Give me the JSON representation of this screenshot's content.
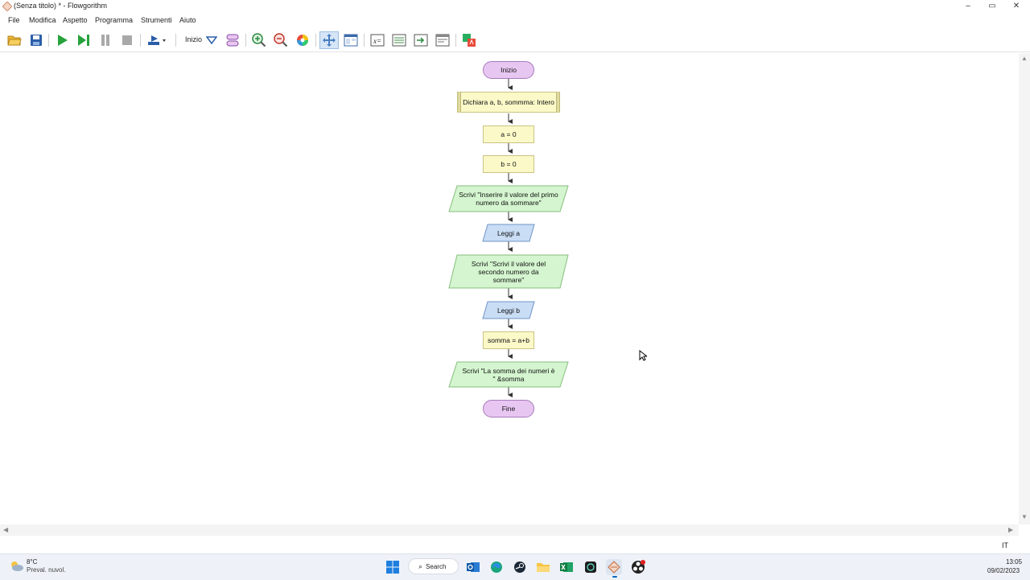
{
  "window": {
    "title": "(Senza titolo) * - Flowgorithm",
    "minimize_glyph": "–",
    "maximize_glyph": "▭",
    "close_glyph": "✕"
  },
  "menu": {
    "items": [
      "File",
      "Modifica",
      "Aspetto",
      "Programma",
      "Strumenti",
      "Aiuto"
    ]
  },
  "toolbar": {
    "start_label": "Inizio",
    "icons": [
      "open-folder-icon",
      "save-icon",
      "run-icon",
      "step-icon",
      "pause-icon",
      "stop-icon",
      "run-options-icon",
      "dropdown-arrow-icon",
      "layout-icon",
      "zoom-in-icon",
      "zoom-out-icon",
      "color-wheel-icon",
      "move-icon",
      "panels-icon",
      "variable-watch-icon",
      "console-icon",
      "output-icon",
      "source-view-icon",
      "translate-icon"
    ]
  },
  "flowchart": {
    "nodes": [
      {
        "id": "start",
        "type": "terminal",
        "text": "Inizio"
      },
      {
        "id": "declare",
        "type": "declare",
        "text": "Dichiara a, b, sommma: Intero"
      },
      {
        "id": "assign_a",
        "type": "assign",
        "text": "a = 0"
      },
      {
        "id": "assign_b",
        "type": "assign",
        "text": "b = 0"
      },
      {
        "id": "output1",
        "type": "output",
        "text": "Scrivi \"Inserire il valore del primo numero da sommare\""
      },
      {
        "id": "input_a",
        "type": "input",
        "text": "Leggi a"
      },
      {
        "id": "output2",
        "type": "output",
        "text": "Scrivi \"Scrivi il valore del secondo numero da sommare\""
      },
      {
        "id": "input_b",
        "type": "input",
        "text": "Leggi b"
      },
      {
        "id": "assign_sum",
        "type": "assign",
        "text": "somma = a+b"
      },
      {
        "id": "output3",
        "type": "output",
        "text": "Scrivi \"La somma dei numeri è \" &somma"
      },
      {
        "id": "end",
        "type": "terminal",
        "text": "Fine"
      }
    ],
    "colors": {
      "terminal": "#e8c6f2",
      "assign": "#fbf9c8",
      "output": "#d4f5cf",
      "input": "#c9ddf5"
    }
  },
  "status": {
    "language": "IT"
  },
  "taskbar": {
    "weather_temp": "8°C",
    "weather_desc": "Preval. nuvol.",
    "search_label": "Search",
    "time": "13:05",
    "date": "09/02/2023",
    "apps": [
      "windows-start-icon",
      "outlook-icon",
      "edge-icon",
      "steam-icon",
      "file-explorer-icon",
      "excel-icon",
      "terminal-app-icon",
      "flowgorithm-icon",
      "obs-icon"
    ]
  }
}
